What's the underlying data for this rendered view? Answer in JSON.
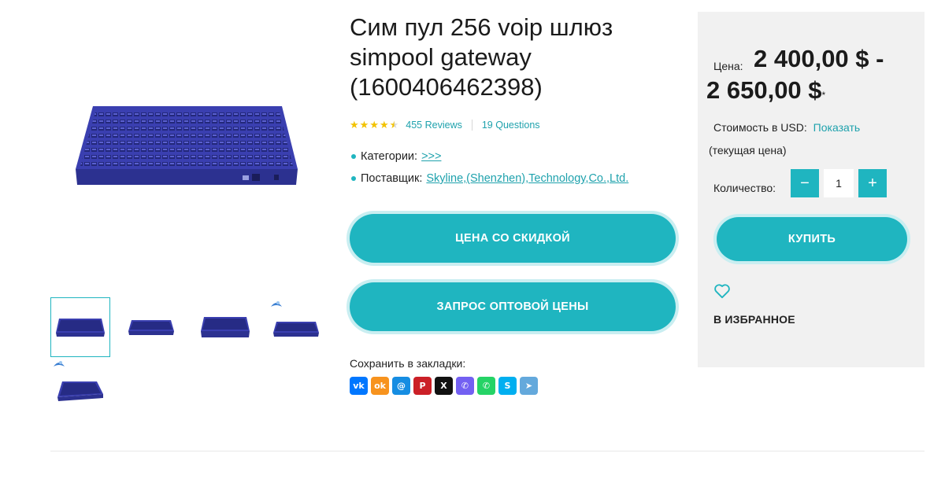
{
  "product": {
    "title": "Сим пул 256 voip шлюз simpool gateway (1600406462398)",
    "rating": 4.5,
    "reviews": "455 Reviews",
    "questions": "19 Questions",
    "categories_label": "Категории:",
    "categories_value": ">>>",
    "supplier_label": "Поставщик:",
    "supplier_value": "Skyline,(Shenzhen),Technology,Co.,Ltd."
  },
  "actions": {
    "discount_label": "ЦЕНА СО СКИДКОЙ",
    "wholesale_label": "ЗАПРОС ОПТОВОЙ ЦЕНЫ"
  },
  "bookmarks": {
    "label": "Сохранить в закладки:",
    "icons": [
      {
        "name": "vk-icon",
        "glyph": "vk",
        "color": "#0077ff"
      },
      {
        "name": "odnoklassniki-icon",
        "glyph": "ok",
        "color": "#f7931e"
      },
      {
        "name": "moimir-icon",
        "glyph": "@",
        "color": "#168de2"
      },
      {
        "name": "pinterest-icon",
        "glyph": "P",
        "color": "#cb2027"
      },
      {
        "name": "x-icon",
        "glyph": "X",
        "color": "#111111"
      },
      {
        "name": "viber-icon",
        "glyph": "✆",
        "color": "#7360f2"
      },
      {
        "name": "whatsapp-icon",
        "glyph": "✆",
        "color": "#25d366"
      },
      {
        "name": "skype-icon",
        "glyph": "S",
        "color": "#00aff0"
      },
      {
        "name": "telegram-icon",
        "glyph": "➤",
        "color": "#64a9dc"
      }
    ]
  },
  "price": {
    "label": "Цена:",
    "range_line1": "2 400,00 $ -",
    "range_line2": "2 650,00 $",
    "asterisk": "*",
    "usd_label": "Стоимость в USD:",
    "usd_link": "Показать",
    "current_note": "(текущая цена)",
    "qty_label": "Количество:",
    "qty_value": "1",
    "minus": "−",
    "plus": "+",
    "buy_label": "КУПИТЬ",
    "favorite_label": "В ИЗБРАННОЕ"
  },
  "colors": {
    "accent": "#1fb5c0",
    "star": "#f2c200",
    "device": "#3a3fb0",
    "panel_bg": "#f1f1f1"
  }
}
